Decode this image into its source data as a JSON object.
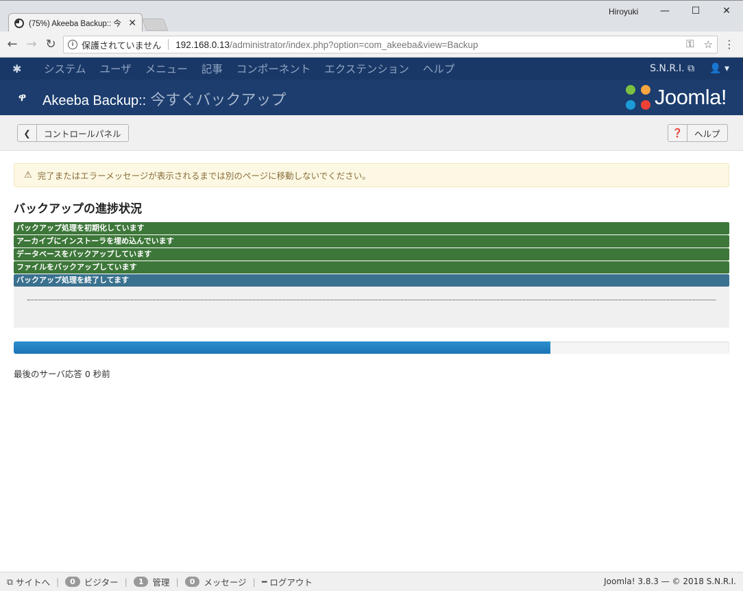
{
  "browser": {
    "tab_title": "(75%) Akeeba Backup:: 今",
    "window_user": "Hiroyuki",
    "security_label": "保護されていません",
    "url_host": "192.168.0.13",
    "url_path": "/administrator/index.php?option=com_akeeba&view=Backup"
  },
  "navbar": {
    "items": [
      "システム",
      "ユーザ",
      "メニュー",
      "記事",
      "コンポーネント",
      "エクステンション",
      "ヘルプ"
    ],
    "site_link": "S.N.R.I."
  },
  "header": {
    "title_main": "Akeeba Backup::",
    "title_sub": " 今すぐバックアップ",
    "brand_word": "Joomla!"
  },
  "toolbar": {
    "back_label": "コントロールパネル",
    "help_label": "ヘルプ"
  },
  "alert": {
    "message": "完了またはエラーメッセージが表示されるまでは別のページに移動しないでください。"
  },
  "progress": {
    "title": "バックアップの進捗状況",
    "steps": [
      {
        "label": "バックアップ処理を初期化しています",
        "state": "done"
      },
      {
        "label": "アーカイブにインストーラを埋め込んでいます",
        "state": "done"
      },
      {
        "label": "データベースをバックアップしています",
        "state": "done"
      },
      {
        "label": "ファイルをバックアップしています",
        "state": "done"
      },
      {
        "label": "バックアップ処理を終了してます",
        "state": "active"
      }
    ],
    "percent": 75,
    "last_response": "最後のサーバ応答 0 秒前"
  },
  "status_bar": {
    "site_label": "サイトへ",
    "visitors_count": "0",
    "visitors_label": "ビジター",
    "admins_count": "1",
    "admins_label": "管理",
    "messages_count": "0",
    "messages_label": "メッセージ",
    "logout_label": "ログアウト",
    "version": "Joomla! 3.8.3 — © 2018 S.N.R.I."
  },
  "colors": {
    "navbar": "#1a3867",
    "header": "#1c3d6e",
    "step_done": "#3d7739",
    "step_active": "#3a718e",
    "progress_fill": "#1a74b5"
  }
}
